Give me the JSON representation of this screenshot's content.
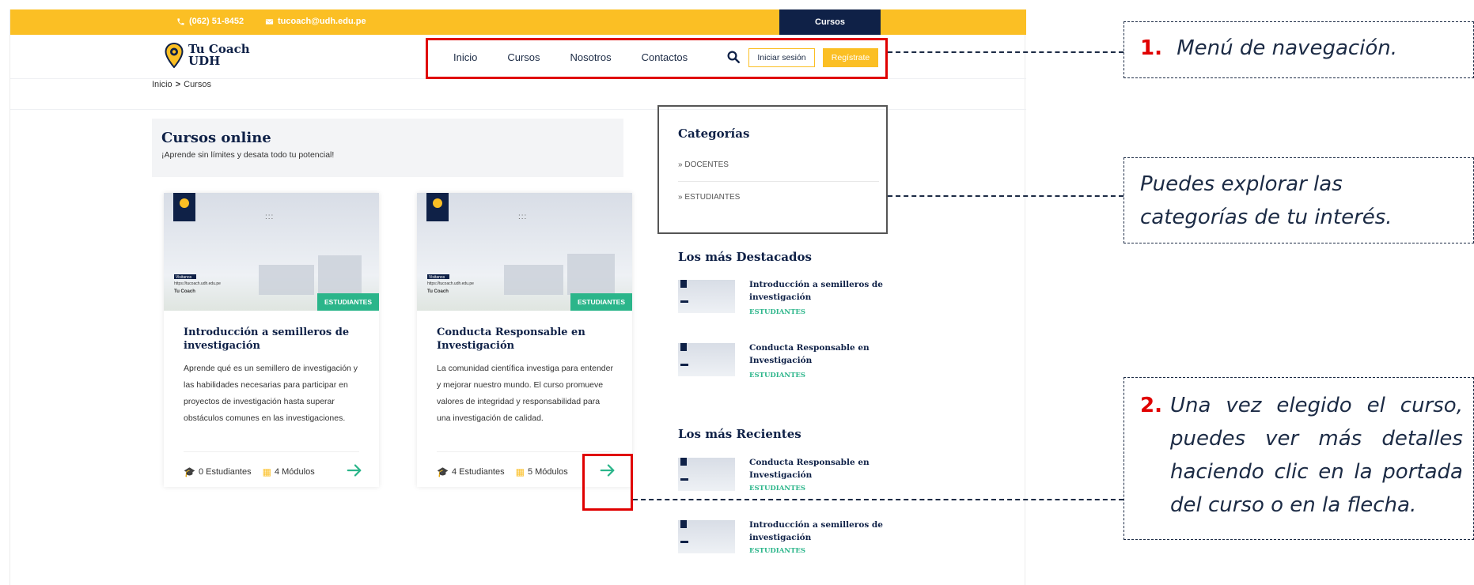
{
  "topbar": {
    "phone": "(062) 51-8452",
    "email": "tucoach@udh.edu.pe",
    "active_tab": "Cursos"
  },
  "brand": {
    "line1": "Tu Coach",
    "line2": "UDH"
  },
  "nav": {
    "items": [
      "Inicio",
      "Cursos",
      "Nosotros",
      "Contactos"
    ],
    "login": "Iniciar sesión",
    "register": "Regístrate"
  },
  "breadcrumb": {
    "home": "Inicio",
    "separator": ">",
    "current": "Cursos"
  },
  "hero": {
    "title": "Cursos online",
    "subtitle": "¡Aprende sin límites y desata todo tu potencial!"
  },
  "courses": [
    {
      "badge": "ESTUDIANTES",
      "cover_tag": "Visitanos",
      "cover_url": "https://tucoach.udh.edu.pe",
      "title": "Introducción a semilleros de investigación",
      "description": "Aprende qué es un semillero de investigación y las habilidades necesarias para participar en proyectos de investigación hasta superar obstáculos comunes en las investigaciones.",
      "students": "0 Estudiantes",
      "modules": "4 Módulos"
    },
    {
      "badge": "ESTUDIANTES",
      "cover_tag": "Visitanos",
      "cover_url": "https://tucoach.udh.edu.pe",
      "title": "Conducta Responsable en Investigación",
      "description": "La comunidad científica investiga para entender y mejorar nuestro mundo. El curso promueve valores de integridad y responsabilidad para una investigación de calidad.",
      "students": "4 Estudiantes",
      "modules": "5 Módulos"
    }
  ],
  "sidebar": {
    "categories_title": "Categorías",
    "categories": [
      "DOCENTES",
      "ESTUDIANTES"
    ],
    "featured_title": "Los más Destacados",
    "featured": [
      {
        "title": "Introducción a semilleros de investigación",
        "tag": "ESTUDIANTES"
      },
      {
        "title": "Conducta Responsable en Investigación",
        "tag": "ESTUDIANTES"
      }
    ],
    "recent_title": "Los más Recientes",
    "recent": [
      {
        "title": "Conducta Responsable en Investigación",
        "tag": "ESTUDIANTES"
      },
      {
        "title": "Introducción a semilleros de investigación",
        "tag": "ESTUDIANTES"
      }
    ]
  },
  "annotations": {
    "note1_number": "1.",
    "note1_text": "Menú de navegación.",
    "note2_text": "Puedes explorar las categorías de tu interés.",
    "note3_number": "2.",
    "note3_text": "Una vez elegido el curso, puedes ver más detalles haciendo clic en la portada del curso o en la flecha."
  },
  "colors": {
    "accent": "#fbbf24",
    "navy": "#0f2147",
    "badge": "#2bb58a",
    "highlight": "#e00000"
  }
}
